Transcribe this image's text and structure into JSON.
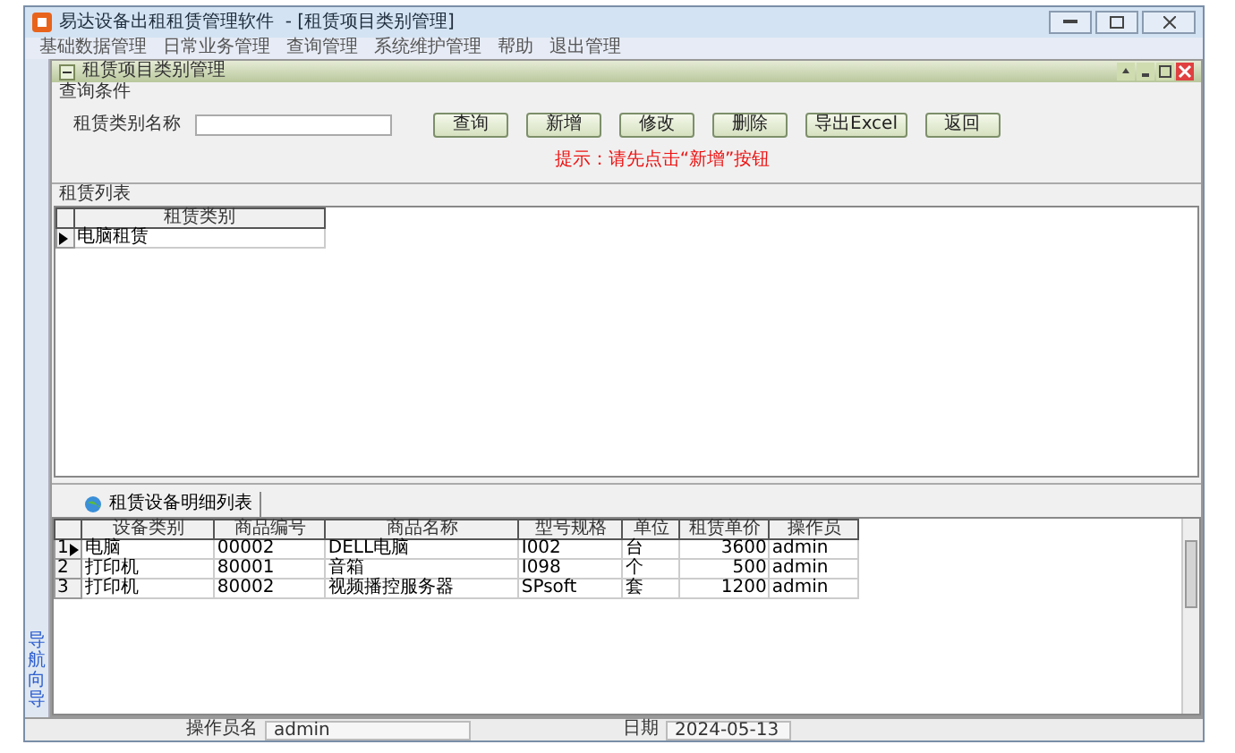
{
  "window": {
    "title": "易达设备出租租赁管理软件  - [租赁项目类别管理]"
  },
  "menu": [
    "基础数据管理",
    "日常业务管理",
    "查询管理",
    "系统维护管理",
    "帮助",
    "退出管理"
  ],
  "sidebar": {
    "label": "导航向导"
  },
  "child_window": {
    "title": "租赁项目类别管理"
  },
  "query": {
    "group_label": "查询条件",
    "field_label": "租赁类别名称",
    "buttons": [
      "查询",
      "新增",
      "修改",
      "删除",
      "导出Excel",
      "返回"
    ],
    "hint": "提示：请先点击“新增”按钮"
  },
  "category_list": {
    "group_label": "租赁列表",
    "columns": [
      "租赁类别"
    ],
    "rows": [
      {
        "selected": true,
        "cells": [
          "电脑租赁"
        ]
      }
    ]
  },
  "detail": {
    "tab": "租赁设备明细列表",
    "columns": [
      "设备类别",
      "商品编号",
      "商品名称",
      "型号规格",
      "单位",
      "租赁单价",
      "操作员"
    ],
    "rows": [
      {
        "number": "1",
        "selected": true,
        "cells": [
          "电脑",
          "00002",
          "DELL电脑",
          "I002",
          "台",
          "3600",
          "admin"
        ]
      },
      {
        "number": "2",
        "selected": false,
        "cells": [
          "打印机",
          "80001",
          "音箱",
          "I098",
          "个",
          "500",
          "admin"
        ]
      },
      {
        "number": "3",
        "selected": false,
        "cells": [
          "打印机",
          "80002",
          "视频播控服务器",
          "SPsoft",
          "套",
          "1200",
          "admin"
        ]
      }
    ]
  },
  "status_bar": {
    "operator_label": "操作员名",
    "operator": "admin",
    "date_label": "日期",
    "date": "2024-05-13"
  }
}
